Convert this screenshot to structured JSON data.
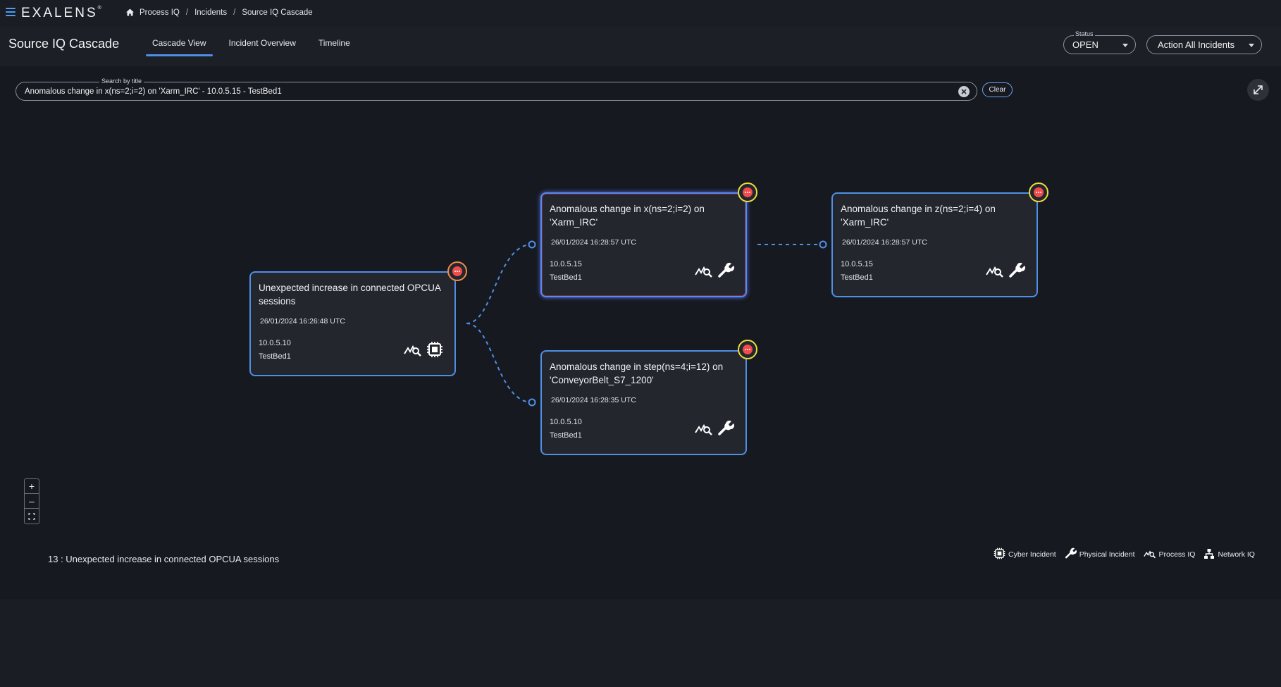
{
  "app": {
    "brand": "EXALENS",
    "trademark": "®"
  },
  "breadcrumb": {
    "items": [
      "Process IQ",
      "Incidents",
      "Source IQ Cascade"
    ],
    "separator": "/"
  },
  "header": {
    "title": "Source IQ Cascade",
    "tabs": [
      {
        "label": "Cascade View",
        "active": true
      },
      {
        "label": "Incident Overview",
        "active": false
      },
      {
        "label": "Timeline",
        "active": false
      }
    ],
    "status_select": {
      "legend": "Status",
      "value": "OPEN"
    },
    "action_select": {
      "value": "Action All Incidents"
    }
  },
  "search": {
    "legend": "Search by title",
    "value": "Anomalous change in x(ns=2;i=2) on 'Xarm_IRC' - 10.0.5.15 - TestBed1",
    "clear_label": "Clear"
  },
  "nodes": [
    {
      "id": "n1",
      "title": "Unexpected increase in connected OPCUA sessions",
      "time": "26/01/2024 16:26:48 UTC",
      "ip": "10.0.5.10",
      "bed": "TestBed1",
      "icons": [
        "process-iq-icon",
        "cyber-incident-icon"
      ]
    },
    {
      "id": "n2",
      "title": "Anomalous change in x(ns=2;i=2) on 'Xarm_IRC'",
      "time": "26/01/2024 16:28:57 UTC",
      "ip": "10.0.5.15",
      "bed": "TestBed1",
      "icons": [
        "process-iq-icon",
        "physical-incident-icon"
      ],
      "selected": true
    },
    {
      "id": "n3",
      "title": "Anomalous change in z(ns=2;i=4) on 'Xarm_IRC'",
      "time": "26/01/2024 16:28:57 UTC",
      "ip": "10.0.5.15",
      "bed": "TestBed1",
      "icons": [
        "process-iq-icon",
        "physical-incident-icon"
      ]
    },
    {
      "id": "n4",
      "title": "Anomalous change in step(ns=4;i=12) on 'ConveyorBelt_S7_1200'",
      "time": "26/01/2024 16:28:35 UTC",
      "ip": "10.0.5.10",
      "bed": "TestBed1",
      "icons": [
        "process-iq-icon",
        "physical-incident-icon"
      ]
    }
  ],
  "zoom_controls": {
    "zoom_in": "+",
    "zoom_out": "–",
    "fit": "fit-view-icon"
  },
  "status_line": "13 : Unexpected increase in connected OPCUA sessions",
  "legend": [
    {
      "icon": "cyber-incident-icon",
      "label": "Cyber Incident"
    },
    {
      "icon": "physical-incident-icon",
      "label": "Physical Incident"
    },
    {
      "icon": "process-iq-icon",
      "label": "Process IQ"
    },
    {
      "icon": "network-iq-icon",
      "label": "Network IQ"
    }
  ],
  "colors": {
    "accent": "#4f8fe6",
    "background": "#16191f",
    "card": "#23262d",
    "badge_ring": "#ecdc3e",
    "badge_ring_root": "#f08a4b",
    "badge_fill": "#f04c4c"
  }
}
